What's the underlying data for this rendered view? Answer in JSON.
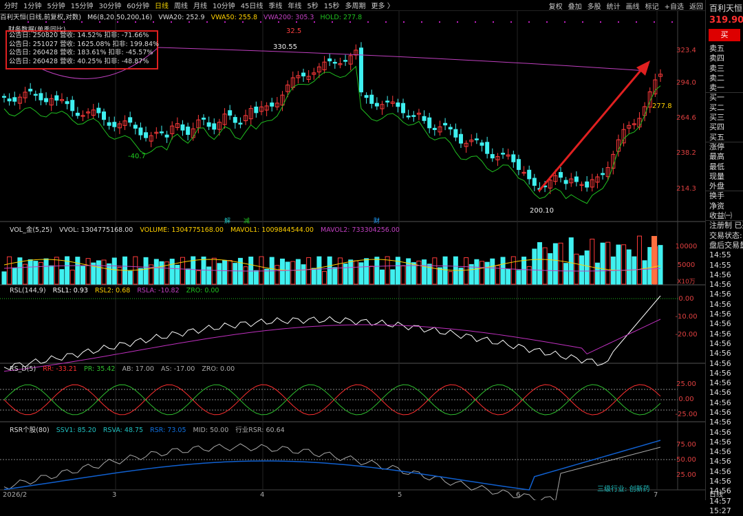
{
  "tabs": [
    "分时",
    "1分钟",
    "5分钟",
    "15分钟",
    "30分钟",
    "60分钟",
    "日线",
    "周线",
    "月线",
    "10分钟",
    "45日线",
    "季线",
    "年线",
    "5秒",
    "15秒",
    "多周期",
    "更多 〉"
  ],
  "active_tab": "日线",
  "right_tools": [
    "复权",
    "叠加",
    "多股",
    "统计",
    "画线",
    "标记",
    "+自选",
    "返回"
  ],
  "info": {
    "name": "百利天恒(日线,前复权,对数)",
    "ma": "M6(8,20,50,200,16)",
    "vwa20": "VWA20: 252.9",
    "vwa50": "VWA50: 255.8",
    "vwa200": "VWA200: 305.3",
    "hold": "HOLD: 277.8"
  },
  "finance": {
    "title": "财务数据(单季同比)",
    "rows": [
      "公告日: 250820  营收: 14.52%   扣非: -71.66%",
      "公告日: 251027  营收: 1625.08%  扣非: 199.84%",
      "公告日: 260428  营收: 183.61%   扣非: -45.57%",
      "公告日: 260428  营收: 40.25%    扣非: -48.87%"
    ]
  },
  "main_axis": [
    "323.4",
    "294.0",
    "264.6",
    "238.2",
    "214.3"
  ],
  "main_axis_top": "32.5",
  "annotations": {
    "high": "330.55",
    "low": "200.10",
    "left_low": "-40.7",
    "hold_val": "277.8",
    "tag1": "解",
    "tag2": "减",
    "tag3": "财"
  },
  "vol": {
    "legend": [
      "VOL_金(5,25)",
      "VVOL: 1304775168.00",
      "VOLUME: 1304775168.00",
      "MAVOL1: 1009844544.00",
      "MAVOL2: 733304256.00"
    ],
    "axis": [
      "10000",
      "5000"
    ],
    "unit": "X10万"
  },
  "rsl": {
    "legend": [
      "RSL(144,9)",
      "RSL1: 0.93",
      "RSL2: 0.68",
      "RSLA: -10.82",
      "ZRO: 0.00"
    ],
    "axis": [
      "0.00",
      "-10.00",
      "-20.00"
    ]
  },
  "rsd": {
    "legend": [
      "RS_D(5)",
      "RR: -33.21",
      "PR: 35.42",
      "AB: 17.00",
      "AS: -17.00",
      "ZRO: 0.00"
    ],
    "axis": [
      "25.00",
      "0.00",
      "-25.00"
    ]
  },
  "rsr": {
    "legend": [
      "RSR个股(80)",
      "SSV1: 85.20",
      "RSVA: 48.75",
      "RSR: 73.05",
      "MID: 50.00",
      "行业RSR: 60.64"
    ],
    "axis": [
      "75.00",
      "50.00",
      "25.00"
    ],
    "industry": "三级行业: 创新药"
  },
  "xaxis": [
    "2026/2",
    "3",
    "4",
    "5",
    "6",
    "7"
  ],
  "right_panel": {
    "name": "百利天恒",
    "price": "319.90",
    "buy": "买",
    "rows": [
      "卖五",
      "卖四",
      "卖三",
      "卖二",
      "卖一",
      "买一",
      "买二",
      "买三",
      "买四",
      "买五",
      "涨停",
      "最高",
      "最低",
      "现量",
      "外盘",
      "换手",
      "净资",
      "收益㈠",
      "注册制 已盈",
      "交易状态:",
      "盘后交易量",
      "14:55",
      "14:55",
      "14:56",
      "14:56",
      "14:56",
      "14:56",
      "14:56",
      "14:56",
      "14:56",
      "14:56",
      "14:56",
      "14:56",
      "14:56",
      "14:56",
      "14:56",
      "14:56",
      "14:56",
      "14:56",
      "14:56",
      "14:56",
      "14:56",
      "14:56",
      "14:56",
      "14:56",
      "14:56",
      "14:57",
      "15:27"
    ],
    "bottom": "日线"
  },
  "colors": {
    "up": "#ff3b3b",
    "down": "#3ff0f0",
    "vwa50": "#ffd000",
    "vwa200": "#c040c0",
    "hold": "#20c020",
    "rsl1": "#ffffff",
    "rsla": "#c030c0",
    "rr": "#ff3030",
    "pr": "#30c030",
    "rsr_gray": "#aaaaaa",
    "rsr_blue": "#1060d0",
    "arrow": "#e02020"
  }
}
